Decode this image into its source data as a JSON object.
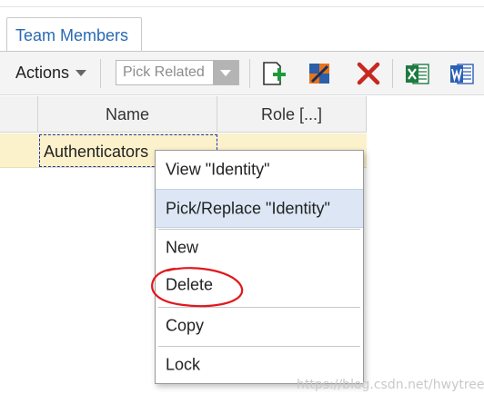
{
  "tabs": [
    {
      "label": "Team Members",
      "active": true
    }
  ],
  "toolbar": {
    "actions_label": "Actions",
    "pick_select": {
      "value": "Pick Related",
      "disabled": true
    },
    "icons": [
      "add-new-icon",
      "pick-related-icon",
      "delete-icon",
      "excel-export-icon",
      "word-export-icon"
    ]
  },
  "grid": {
    "columns": [
      "Name",
      "Role [...]"
    ],
    "rows": [
      {
        "name": "Authenticators",
        "role": ""
      }
    ]
  },
  "context_menu": {
    "items": [
      {
        "label": "View \"Identity\"",
        "highlighted": false
      },
      {
        "label": "Pick/Replace \"Identity\"",
        "highlighted": true
      },
      {
        "label": "New",
        "highlighted": false
      },
      {
        "label": "Delete",
        "highlighted": false
      },
      {
        "label": "Copy",
        "highlighted": false
      },
      {
        "label": "Lock",
        "highlighted": false
      }
    ]
  },
  "annotation": {
    "circled_item": "Delete",
    "color": "#e0191e"
  },
  "watermark": "https://blog.csdn.net/hwytree",
  "colors": {
    "accent": "#2a6ab3",
    "row_selected": "#fbf1cb",
    "menu_highlight": "#dce6f4"
  }
}
